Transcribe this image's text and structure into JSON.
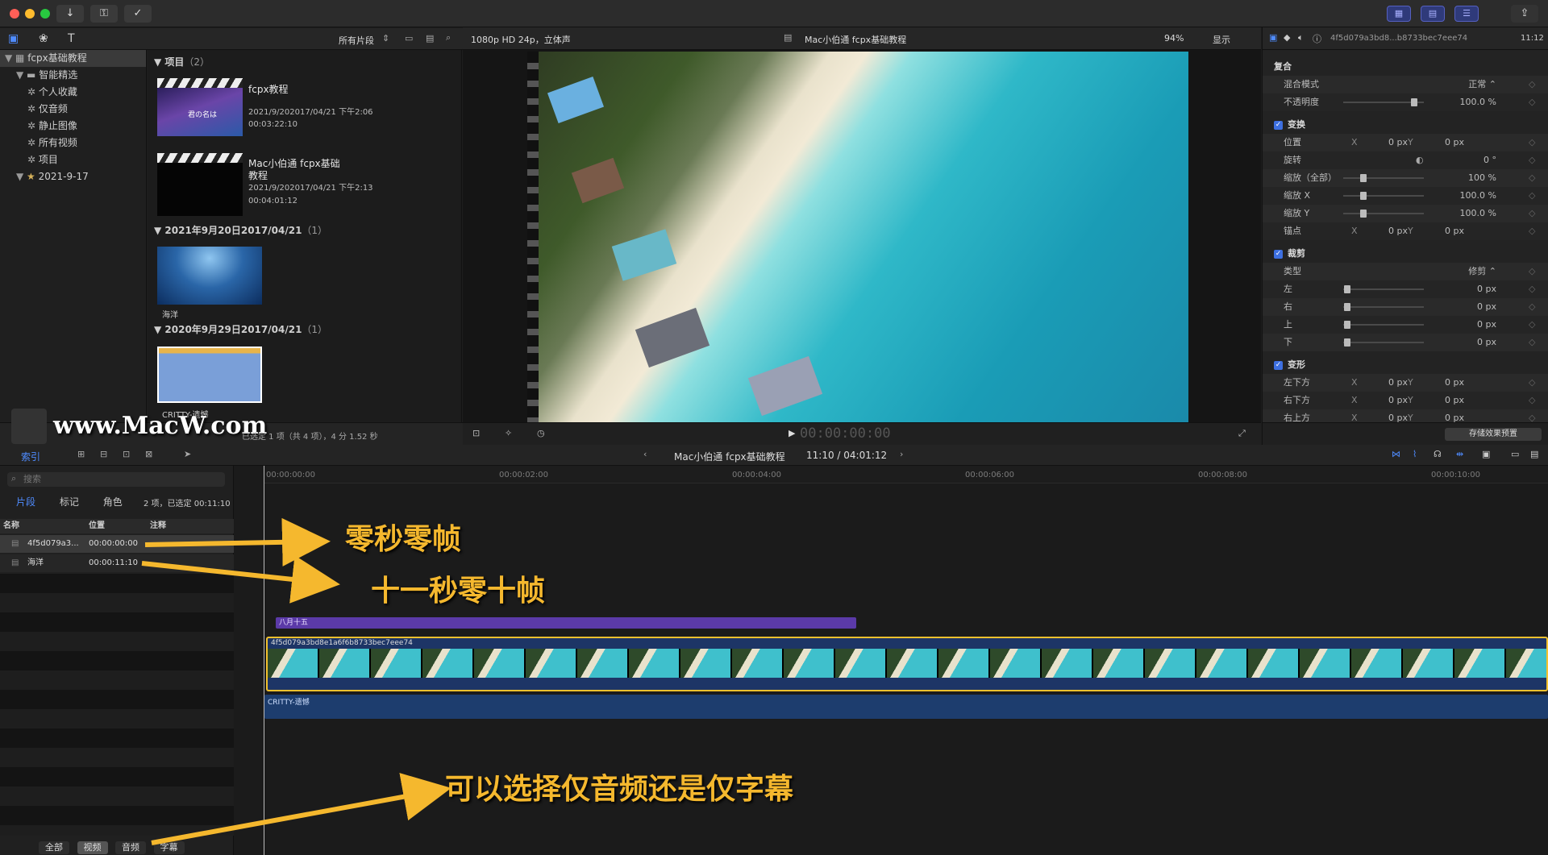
{
  "toolbar": {
    "buttons": [
      "download-icon",
      "key-icon",
      "checkmark-icon"
    ],
    "right_buttons": [
      "grid-icon",
      "filmstrip-icon",
      "sliders-icon"
    ],
    "share": "share-icon"
  },
  "library": {
    "filter_label": "所有片段",
    "items": [
      {
        "label": "fcpx基础教程",
        "indent": 0,
        "icon": "library-icon"
      },
      {
        "label": "智能精选",
        "indent": 1,
        "icon": "folder-icon"
      },
      {
        "label": "个人收藏",
        "indent": 2,
        "icon": "gear-icon"
      },
      {
        "label": "仅音频",
        "indent": 2,
        "icon": "gear-icon"
      },
      {
        "label": "静止图像",
        "indent": 2,
        "icon": "gear-icon"
      },
      {
        "label": "所有视频",
        "indent": 2,
        "icon": "gear-icon"
      },
      {
        "label": "项目",
        "indent": 2,
        "icon": "gear-icon"
      },
      {
        "label": "2021-9-17",
        "indent": 1,
        "icon": "event-icon"
      }
    ]
  },
  "browser": {
    "section1": {
      "title": "项目",
      "count": "（2）"
    },
    "clip1": {
      "title": "fcpx教程",
      "date": "2021/9/202017/04/21 下午2:06",
      "duration": "00:03:22:10"
    },
    "clip2": {
      "title_line1": "Mac小伯通 fcpx基础",
      "title_line2": "教程",
      "date": "2021/9/202017/04/21 下午2:13",
      "duration": "00:04:01:12"
    },
    "section2": {
      "title": "2021年9月20日2017/04/21",
      "count": "（1）"
    },
    "clip3": {
      "title": "海洋"
    },
    "section3": {
      "title": "2020年9月29日2017/04/21",
      "count": "（1）"
    },
    "clip4": {
      "title": "CRITTY-遗憾"
    },
    "status": "已选定 1 项（共 4 项），4 分 1.52 秒",
    "watermark": "www.MacW.com"
  },
  "viewer": {
    "format": "1080p HD 24p，立体声",
    "project": "Mac小伯通 fcpx基础教程",
    "zoom": "94%",
    "display": "显示",
    "timecode": "00:00:00:00"
  },
  "inspector": {
    "clip_name": "4f5d079a3bd8...b8733bec7eee74",
    "time": "11:12",
    "sections": [
      {
        "title": "复合",
        "checked": false,
        "rows": [
          {
            "label": "混合模式",
            "value": "正常 ⌃"
          },
          {
            "label": "不透明度",
            "value": "100.0 %",
            "slider": 0.88
          }
        ]
      },
      {
        "title": "变换",
        "checked": true,
        "rows": [
          {
            "label": "位置",
            "x": "0 px",
            "y": "0 px"
          },
          {
            "label": "旋转",
            "value": "0 °",
            "dial": true
          },
          {
            "label": "缩放（全部）",
            "value": "100 %",
            "slider": 0.25
          },
          {
            "label": "缩放 X",
            "value": "100.0 %",
            "slider": 0.25
          },
          {
            "label": "缩放 Y",
            "value": "100.0 %",
            "slider": 0.25
          },
          {
            "label": "锚点",
            "x": "0 px",
            "y": "0 px"
          }
        ]
      },
      {
        "title": "裁剪",
        "checked": true,
        "rows": [
          {
            "label": "类型",
            "value": "修剪 ⌃"
          },
          {
            "label": "左",
            "value": "0 px",
            "slider": 0.05
          },
          {
            "label": "右",
            "value": "0 px",
            "slider": 0.05
          },
          {
            "label": "上",
            "value": "0 px",
            "slider": 0.05
          },
          {
            "label": "下",
            "value": "0 px",
            "slider": 0.05
          }
        ]
      },
      {
        "title": "变形",
        "checked": true,
        "rows": [
          {
            "label": "左下方",
            "x": "0 px",
            "y": "0 px"
          },
          {
            "label": "右下方",
            "x": "0 px",
            "y": "0 px"
          },
          {
            "label": "右上方",
            "x": "0 px",
            "y": "0 px"
          }
        ]
      }
    ],
    "save_preset": "存储效果预置"
  },
  "timeline": {
    "index_tab": "索引",
    "project": "Mac小伯通 fcpx基础教程",
    "position": "11:10 / 04:01:12",
    "ruler": [
      "00:00:00:00",
      "00:00:02:00",
      "00:00:04:00",
      "00:00:06:00",
      "00:00:08:00",
      "00:00:10:00"
    ],
    "title_clip": "八月十五",
    "video_clip": "4f5d079a3bd8e1a6f6b8733bec7eee74",
    "audio_clip": "CRITTY-遗憾"
  },
  "index": {
    "search_placeholder": "搜索",
    "tabs": [
      "片段",
      "标记",
      "角色"
    ],
    "summary": "2 项，已选定 00:11:10",
    "columns": [
      "名称",
      "位置",
      "注释"
    ],
    "rows": [
      {
        "name": "4f5d079a3...",
        "position": "00:00:00:00"
      },
      {
        "name": "海洋",
        "position": "00:00:11:10"
      }
    ],
    "filter_tabs": [
      "全部",
      "视频",
      "音频",
      "字幕"
    ]
  },
  "annotations": {
    "a1": "零秒零帧",
    "a2": "十一秒零十帧",
    "a3": "可以选择仅音频还是仅字幕"
  },
  "colors": {
    "accent": "#3d6fe0",
    "annotation": "#f5b82e",
    "title_clip": "#5b3aa8",
    "audio_clip": "#1d3d6e",
    "selection": "#f2c12e"
  }
}
